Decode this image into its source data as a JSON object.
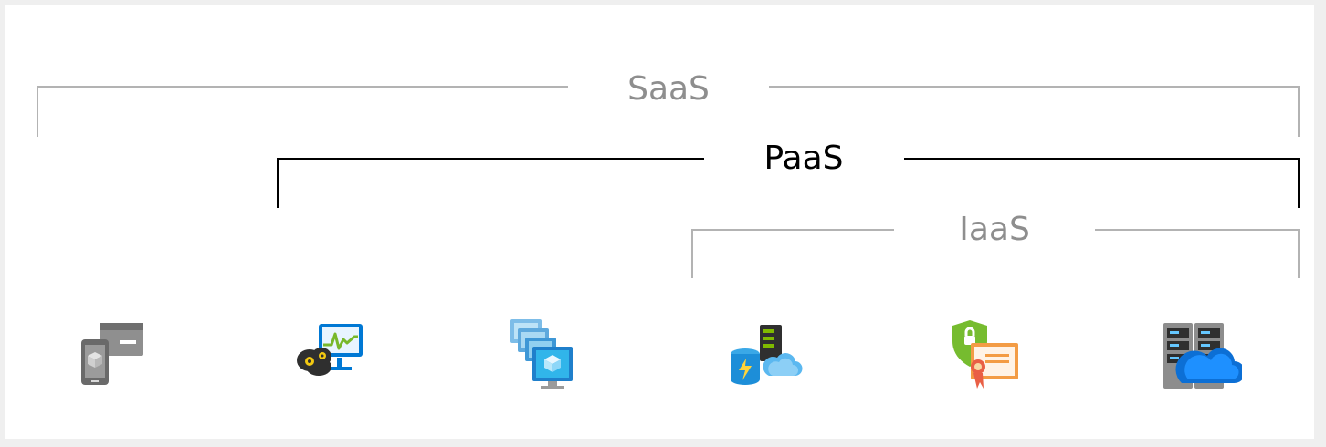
{
  "labels": {
    "saas": "SaaS",
    "paas": "PaaS",
    "iaas": "IaaS"
  },
  "icons": [
    "mobile-app-icon",
    "monitoring-gear-icon",
    "virtual-machines-icon",
    "database-cloud-icon",
    "security-certificate-icon",
    "server-cloud-icon"
  ],
  "colors": {
    "saas": "#a6a6a6",
    "paas": "#000000",
    "iaas": "#a6a6a6",
    "azure_blue": "#1ba1e2",
    "gray": "#7a7a7a"
  }
}
